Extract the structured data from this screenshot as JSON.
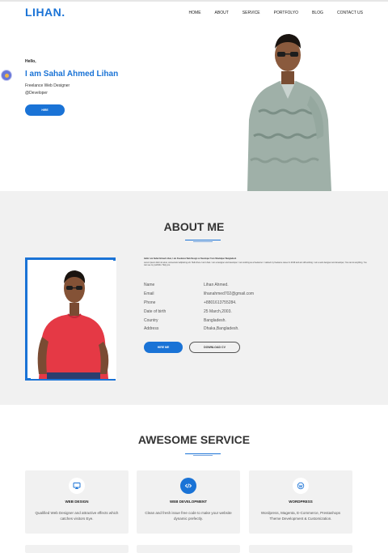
{
  "header": {
    "logo": "LIHAN.",
    "nav": [
      "HOME",
      "ABOUT",
      "SERVICE",
      "PORTFOLYO",
      "BLOG",
      "CONTACT US"
    ]
  },
  "hero": {
    "greeting": "Hello,",
    "name": "I am Sahal Ahmed Lihan",
    "role": "Freelance Web Designer",
    "handle": "@Developer",
    "cta": "HIRE"
  },
  "about": {
    "title": "ABOUT ME",
    "intro_heading": "Hello I am Sahal Ahmed Lihan, I am Freelance Web Design or Developer from Sharialpur Bangladesh",
    "intro_text": "Lorem ipsum dolor sit amet, consectetur adipiscing elit. Hello there I am Lihan. I am a designer and developer. I am working as a freelancer. I started my freelance career in 2019 and am still working. I am a web designer and developer, You can do anything, You can see my portfolio. Help you.",
    "info": [
      {
        "label": "Name",
        "value": "Lihan Ahmed."
      },
      {
        "label": "Email",
        "value": "lihanahmed702@gmail.com"
      },
      {
        "label": "Phone",
        "value": "+8801613755284."
      },
      {
        "label": "Date of birth",
        "value": "25 March,2003."
      },
      {
        "label": "Country",
        "value": "Bangladesh."
      },
      {
        "label": "Address",
        "value": "Dhaka,Bangladesh."
      }
    ],
    "hire_btn": "HIRE ME",
    "cv_btn": "DOWNLOAD CV"
  },
  "services": {
    "title": "AWESOME SERVICE",
    "items": [
      {
        "icon": "monitor-icon",
        "title": "WEB DESIGN",
        "desc": "Qualified Web Designer and attractive effects which catches visitors Eye."
      },
      {
        "icon": "code-icon",
        "title": "WEB DEVELOPMENT",
        "desc": "Clean and fresh issue free code to make your website dynamic prefectly."
      },
      {
        "icon": "wordpress-icon",
        "title": "WORDPRESS",
        "desc": "Wordpress, Magenta, E-Commerce, Prestashops Theme Development & Customization."
      }
    ]
  },
  "colors": {
    "accent": "#1a73d6",
    "section_bg": "#f1f1f1"
  }
}
